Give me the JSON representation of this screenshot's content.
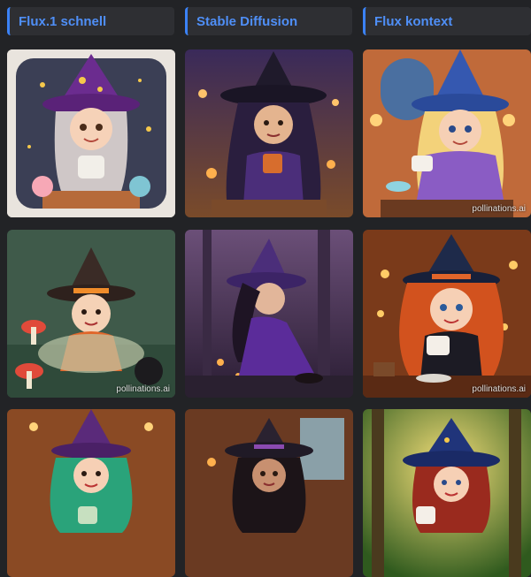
{
  "columns": [
    {
      "label": "Flux.1 schnell"
    },
    {
      "label": "Stable Diffusion"
    },
    {
      "label": "Flux kontext"
    }
  ],
  "watermark": "pollinations.ai",
  "accent_color": "#3b82f6",
  "images": [
    {
      "model": "Flux.1 schnell",
      "subject": "witch with teacup"
    },
    {
      "model": "Stable Diffusion",
      "subject": "witch with mug at tavern"
    },
    {
      "model": "Flux kontext",
      "subject": "witch in blue hat with cup"
    },
    {
      "model": "Flux.1 schnell",
      "subject": "witch in forest with mushrooms"
    },
    {
      "model": "Stable Diffusion",
      "subject": "witch sitting in purple forest"
    },
    {
      "model": "Flux kontext",
      "subject": "red-haired witch with cup"
    },
    {
      "model": "Flux.1 schnell",
      "subject": "green-haired witch with mug"
    },
    {
      "model": "Stable Diffusion",
      "subject": "witch in cozy room"
    },
    {
      "model": "Flux kontext",
      "subject": "witch in glowing forest"
    }
  ]
}
